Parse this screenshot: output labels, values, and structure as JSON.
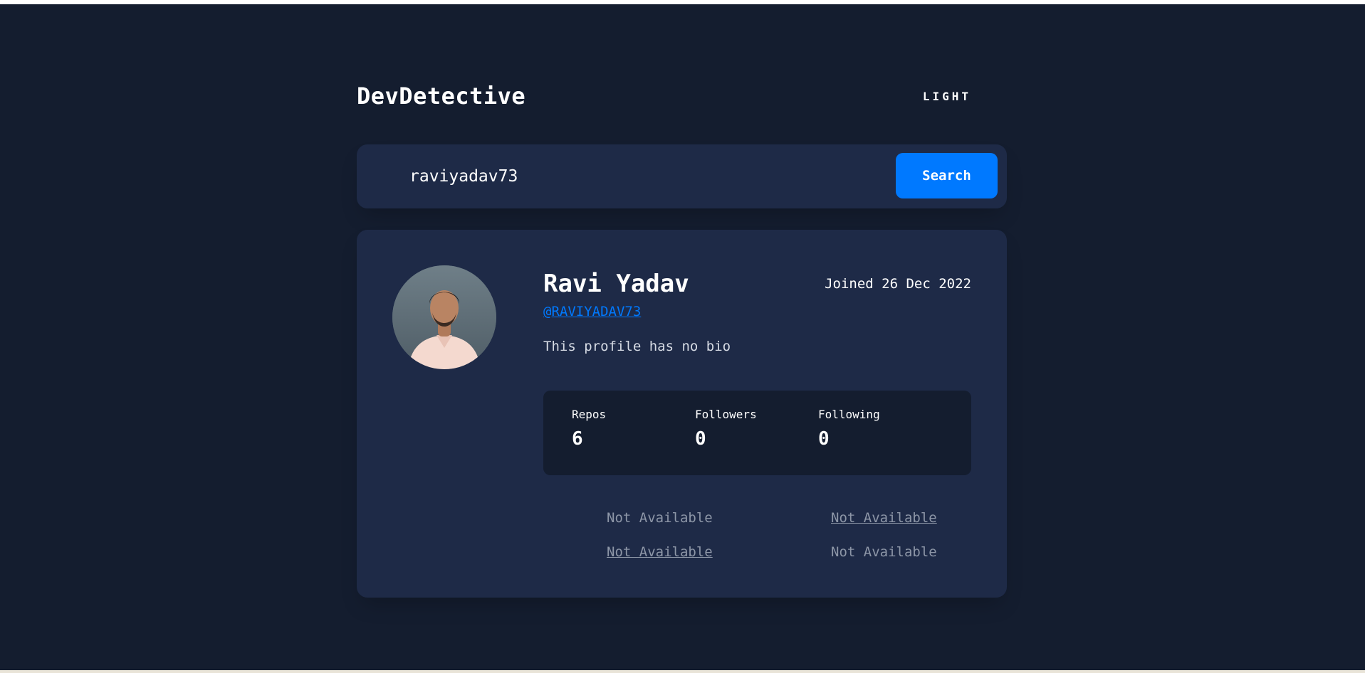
{
  "app": {
    "title": "DevDetective",
    "theme_toggle_label": "LIGHT"
  },
  "search": {
    "value": "raviyadav73",
    "button_label": "Search"
  },
  "profile": {
    "name": "Ravi Yadav",
    "joined": "Joined 26 Dec 2022",
    "login": "@RAVIYADAV73",
    "bio": "This profile has no bio",
    "stats": [
      {
        "label": "Repos",
        "value": "6"
      },
      {
        "label": "Followers",
        "value": "0"
      },
      {
        "label": "Following",
        "value": "0"
      }
    ],
    "links": {
      "location": "Not Available",
      "twitter": "Not Available",
      "website": "Not Available",
      "company": "Not Available"
    }
  },
  "colors": {
    "background": "#141d2f",
    "card": "#1e2a47",
    "accent": "#0079ff",
    "muted_text": "#8d96a7"
  }
}
